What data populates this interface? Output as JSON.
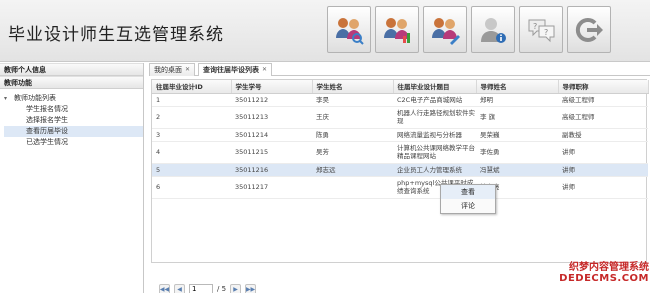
{
  "app": {
    "title": "毕业设计师生互选管理系统"
  },
  "toolbar": {
    "icons": [
      "user-search-icon",
      "user-chart-icon",
      "user-edit-icon",
      "user-info-icon",
      "help-icon",
      "logout-icon"
    ]
  },
  "sidebar": {
    "section1": "教师个人信息",
    "section2": "教师功能",
    "root": "教师功能列表",
    "items": [
      "学生报名情况",
      "选择报名学生",
      "查看历届毕设",
      "已选学生情况"
    ]
  },
  "tabs": [
    {
      "label": "我的桌面"
    },
    {
      "label": "查询往届毕设列表"
    }
  ],
  "table": {
    "headers": [
      "往届毕业设计ID",
      "学生学号",
      "学生姓名",
      "往届毕业设计题目",
      "导师姓名",
      "导师职称"
    ],
    "rows": [
      [
        "1",
        "35011212",
        "李昊",
        "C2C电子产品商城网站",
        "郑明",
        "高级工程师"
      ],
      [
        "2",
        "35011213",
        "王庆",
        "机器人行走路径规划软件实现",
        "李 旗",
        "高级工程师"
      ],
      [
        "3",
        "35011214",
        "陈勇",
        "网络流量监视与分析器",
        "吴荣巍",
        "副教授"
      ],
      [
        "4",
        "35011215",
        "吴芳",
        "计算机公共课网络教学平台精品课程网站",
        "李佐勇",
        "讲师"
      ],
      [
        "5",
        "35011216",
        "郑志远",
        "企业员工人力管理系统",
        "冯慧斌",
        "讲师"
      ],
      [
        "6",
        "35011217",
        "",
        "php+mysql公共课平时成绩查询系统",
        "林东亮",
        "讲师"
      ]
    ]
  },
  "context_menu": {
    "items": [
      "查看",
      "评论"
    ]
  },
  "pager": {
    "page": "1",
    "total": "/ 5"
  },
  "watermark": {
    "cn": "织梦内容管理系统",
    "en": "DEDECMS.COM"
  }
}
